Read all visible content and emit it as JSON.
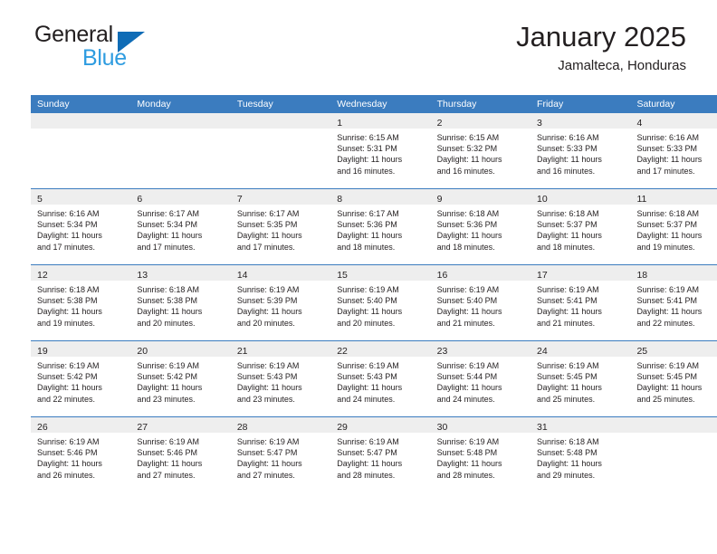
{
  "brand": {
    "word_one": "General",
    "word_two": "Blue",
    "triangle_color": "#0f6cb6",
    "blue_text_color": "#2e9ce0"
  },
  "header": {
    "title": "January 2025",
    "subtitle": "Jamalteca, Honduras",
    "accent_color": "#3b7cbf",
    "band_color": "#eeeeee"
  },
  "weekdays": [
    "Sunday",
    "Monday",
    "Tuesday",
    "Wednesday",
    "Thursday",
    "Friday",
    "Saturday"
  ],
  "weeks": [
    [
      {
        "day": "",
        "empty": true
      },
      {
        "day": "",
        "empty": true
      },
      {
        "day": "",
        "empty": true
      },
      {
        "day": "1",
        "sunrise": "Sunrise: 6:15 AM",
        "sunset": "Sunset: 5:31 PM",
        "daylight_1": "Daylight: 11 hours",
        "daylight_2": "and 16 minutes."
      },
      {
        "day": "2",
        "sunrise": "Sunrise: 6:15 AM",
        "sunset": "Sunset: 5:32 PM",
        "daylight_1": "Daylight: 11 hours",
        "daylight_2": "and 16 minutes."
      },
      {
        "day": "3",
        "sunrise": "Sunrise: 6:16 AM",
        "sunset": "Sunset: 5:33 PM",
        "daylight_1": "Daylight: 11 hours",
        "daylight_2": "and 16 minutes."
      },
      {
        "day": "4",
        "sunrise": "Sunrise: 6:16 AM",
        "sunset": "Sunset: 5:33 PM",
        "daylight_1": "Daylight: 11 hours",
        "daylight_2": "and 17 minutes."
      }
    ],
    [
      {
        "day": "5",
        "sunrise": "Sunrise: 6:16 AM",
        "sunset": "Sunset: 5:34 PM",
        "daylight_1": "Daylight: 11 hours",
        "daylight_2": "and 17 minutes."
      },
      {
        "day": "6",
        "sunrise": "Sunrise: 6:17 AM",
        "sunset": "Sunset: 5:34 PM",
        "daylight_1": "Daylight: 11 hours",
        "daylight_2": "and 17 minutes."
      },
      {
        "day": "7",
        "sunrise": "Sunrise: 6:17 AM",
        "sunset": "Sunset: 5:35 PM",
        "daylight_1": "Daylight: 11 hours",
        "daylight_2": "and 17 minutes."
      },
      {
        "day": "8",
        "sunrise": "Sunrise: 6:17 AM",
        "sunset": "Sunset: 5:36 PM",
        "daylight_1": "Daylight: 11 hours",
        "daylight_2": "and 18 minutes."
      },
      {
        "day": "9",
        "sunrise": "Sunrise: 6:18 AM",
        "sunset": "Sunset: 5:36 PM",
        "daylight_1": "Daylight: 11 hours",
        "daylight_2": "and 18 minutes."
      },
      {
        "day": "10",
        "sunrise": "Sunrise: 6:18 AM",
        "sunset": "Sunset: 5:37 PM",
        "daylight_1": "Daylight: 11 hours",
        "daylight_2": "and 18 minutes."
      },
      {
        "day": "11",
        "sunrise": "Sunrise: 6:18 AM",
        "sunset": "Sunset: 5:37 PM",
        "daylight_1": "Daylight: 11 hours",
        "daylight_2": "and 19 minutes."
      }
    ],
    [
      {
        "day": "12",
        "sunrise": "Sunrise: 6:18 AM",
        "sunset": "Sunset: 5:38 PM",
        "daylight_1": "Daylight: 11 hours",
        "daylight_2": "and 19 minutes."
      },
      {
        "day": "13",
        "sunrise": "Sunrise: 6:18 AM",
        "sunset": "Sunset: 5:38 PM",
        "daylight_1": "Daylight: 11 hours",
        "daylight_2": "and 20 minutes."
      },
      {
        "day": "14",
        "sunrise": "Sunrise: 6:19 AM",
        "sunset": "Sunset: 5:39 PM",
        "daylight_1": "Daylight: 11 hours",
        "daylight_2": "and 20 minutes."
      },
      {
        "day": "15",
        "sunrise": "Sunrise: 6:19 AM",
        "sunset": "Sunset: 5:40 PM",
        "daylight_1": "Daylight: 11 hours",
        "daylight_2": "and 20 minutes."
      },
      {
        "day": "16",
        "sunrise": "Sunrise: 6:19 AM",
        "sunset": "Sunset: 5:40 PM",
        "daylight_1": "Daylight: 11 hours",
        "daylight_2": "and 21 minutes."
      },
      {
        "day": "17",
        "sunrise": "Sunrise: 6:19 AM",
        "sunset": "Sunset: 5:41 PM",
        "daylight_1": "Daylight: 11 hours",
        "daylight_2": "and 21 minutes."
      },
      {
        "day": "18",
        "sunrise": "Sunrise: 6:19 AM",
        "sunset": "Sunset: 5:41 PM",
        "daylight_1": "Daylight: 11 hours",
        "daylight_2": "and 22 minutes."
      }
    ],
    [
      {
        "day": "19",
        "sunrise": "Sunrise: 6:19 AM",
        "sunset": "Sunset: 5:42 PM",
        "daylight_1": "Daylight: 11 hours",
        "daylight_2": "and 22 minutes."
      },
      {
        "day": "20",
        "sunrise": "Sunrise: 6:19 AM",
        "sunset": "Sunset: 5:42 PM",
        "daylight_1": "Daylight: 11 hours",
        "daylight_2": "and 23 minutes."
      },
      {
        "day": "21",
        "sunrise": "Sunrise: 6:19 AM",
        "sunset": "Sunset: 5:43 PM",
        "daylight_1": "Daylight: 11 hours",
        "daylight_2": "and 23 minutes."
      },
      {
        "day": "22",
        "sunrise": "Sunrise: 6:19 AM",
        "sunset": "Sunset: 5:43 PM",
        "daylight_1": "Daylight: 11 hours",
        "daylight_2": "and 24 minutes."
      },
      {
        "day": "23",
        "sunrise": "Sunrise: 6:19 AM",
        "sunset": "Sunset: 5:44 PM",
        "daylight_1": "Daylight: 11 hours",
        "daylight_2": "and 24 minutes."
      },
      {
        "day": "24",
        "sunrise": "Sunrise: 6:19 AM",
        "sunset": "Sunset: 5:45 PM",
        "daylight_1": "Daylight: 11 hours",
        "daylight_2": "and 25 minutes."
      },
      {
        "day": "25",
        "sunrise": "Sunrise: 6:19 AM",
        "sunset": "Sunset: 5:45 PM",
        "daylight_1": "Daylight: 11 hours",
        "daylight_2": "and 25 minutes."
      }
    ],
    [
      {
        "day": "26",
        "sunrise": "Sunrise: 6:19 AM",
        "sunset": "Sunset: 5:46 PM",
        "daylight_1": "Daylight: 11 hours",
        "daylight_2": "and 26 minutes."
      },
      {
        "day": "27",
        "sunrise": "Sunrise: 6:19 AM",
        "sunset": "Sunset: 5:46 PM",
        "daylight_1": "Daylight: 11 hours",
        "daylight_2": "and 27 minutes."
      },
      {
        "day": "28",
        "sunrise": "Sunrise: 6:19 AM",
        "sunset": "Sunset: 5:47 PM",
        "daylight_1": "Daylight: 11 hours",
        "daylight_2": "and 27 minutes."
      },
      {
        "day": "29",
        "sunrise": "Sunrise: 6:19 AM",
        "sunset": "Sunset: 5:47 PM",
        "daylight_1": "Daylight: 11 hours",
        "daylight_2": "and 28 minutes."
      },
      {
        "day": "30",
        "sunrise": "Sunrise: 6:19 AM",
        "sunset": "Sunset: 5:48 PM",
        "daylight_1": "Daylight: 11 hours",
        "daylight_2": "and 28 minutes."
      },
      {
        "day": "31",
        "sunrise": "Sunrise: 6:18 AM",
        "sunset": "Sunset: 5:48 PM",
        "daylight_1": "Daylight: 11 hours",
        "daylight_2": "and 29 minutes."
      },
      {
        "day": "",
        "empty": true
      }
    ]
  ]
}
